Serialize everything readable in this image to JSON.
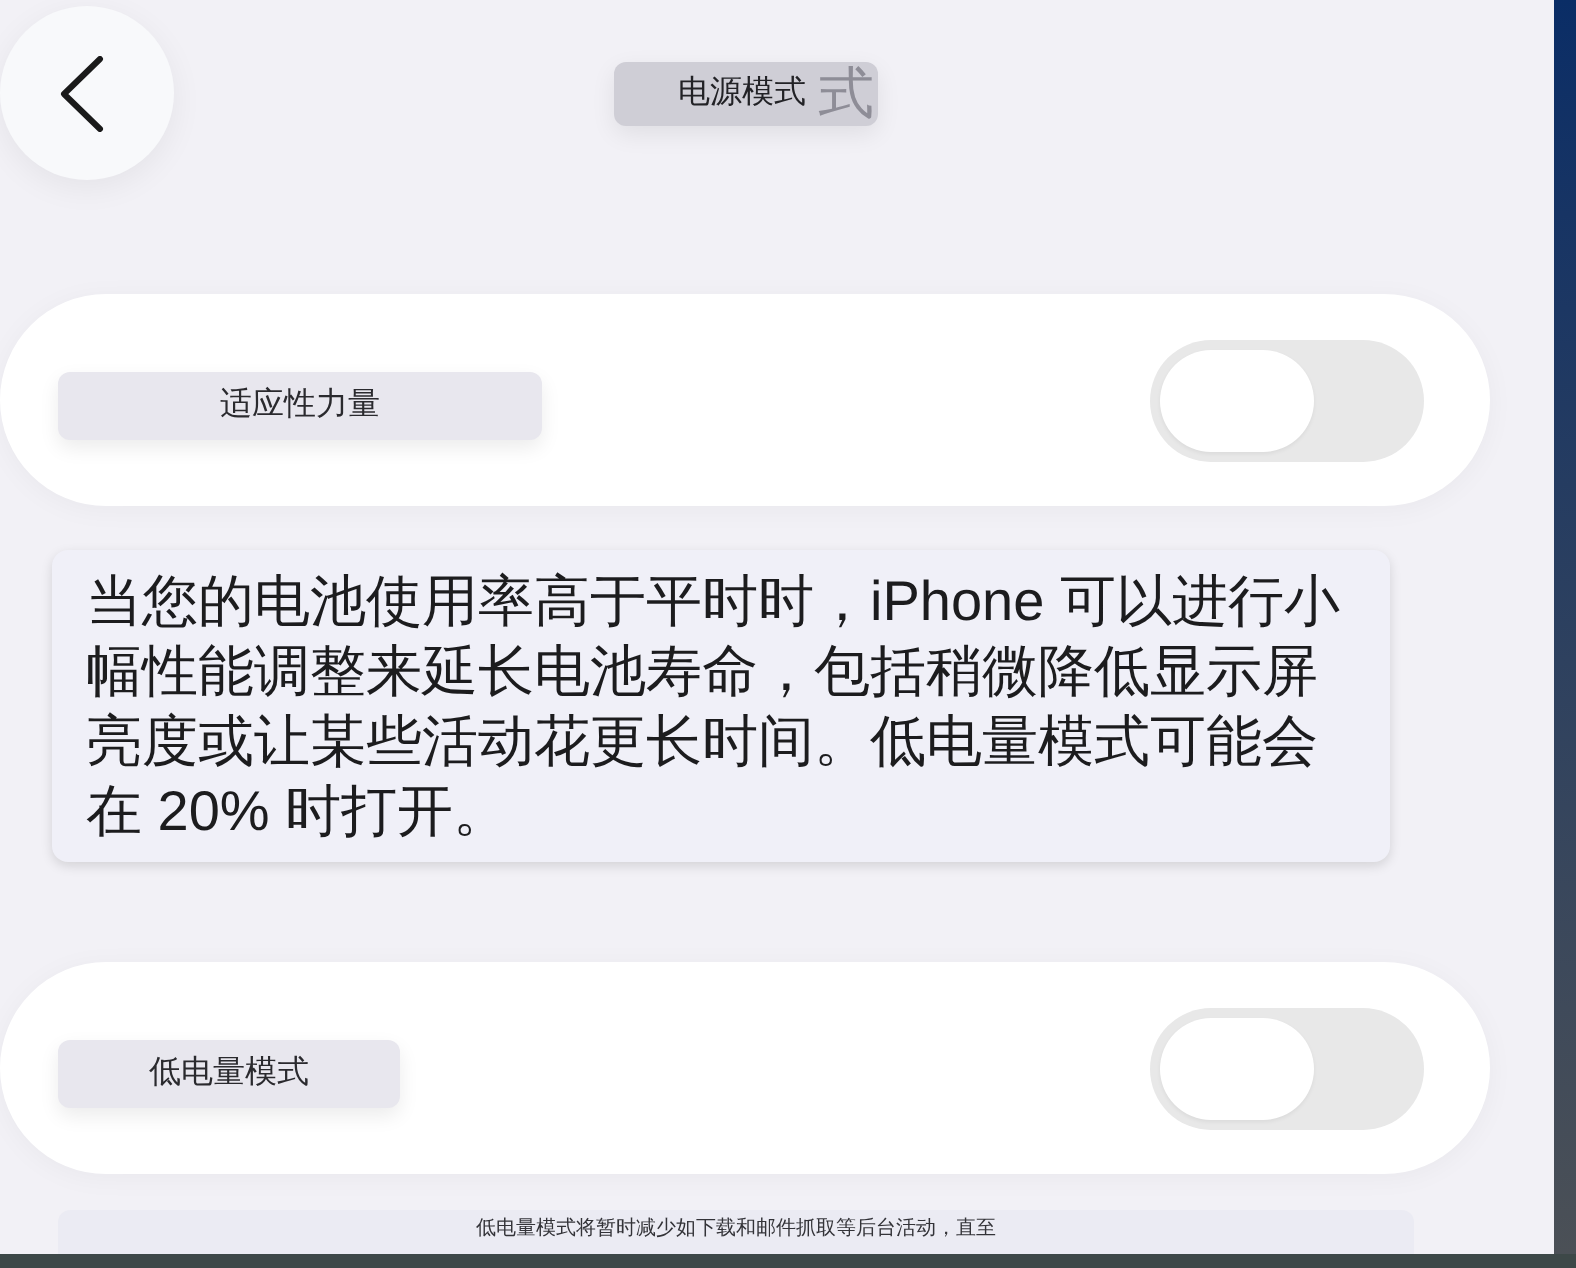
{
  "header": {
    "title": "电源模式",
    "title_echo": "式"
  },
  "settings": [
    {
      "kind": "toggle",
      "label": "适应性力量",
      "on": false
    },
    {
      "kind": "description",
      "text": "当您的电池使用率高于平时时，iPhone 可以进行小幅性能调整来延长电池寿命，包括稍微降低显示屏亮度或让某些活动花更长时间。低电量模式可能会在 20% 时打开。"
    },
    {
      "kind": "toggle",
      "label": "低电量模式",
      "on": false
    },
    {
      "kind": "note",
      "text": "低电量模式将暂时减少如下载和邮件抓取等后台活动，直至"
    }
  ]
}
